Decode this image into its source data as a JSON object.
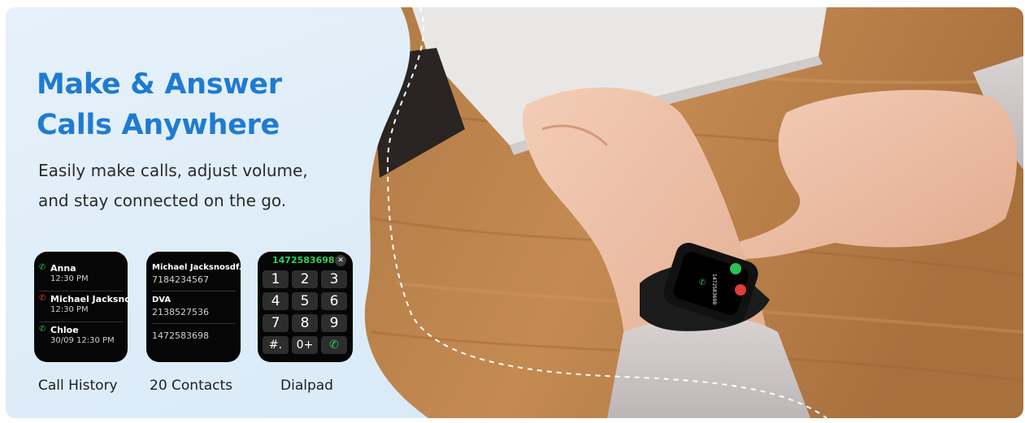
{
  "headline": {
    "line1": "Make & Answer",
    "line2": "Calls Anywhere"
  },
  "subtitle": {
    "line1": "Easily make calls, adjust volume,",
    "line2": "and stay connected on the go."
  },
  "call_history": {
    "entries": [
      {
        "name": "Anna",
        "time": "12:30 PM",
        "status": "incoming",
        "icon": "phone-incoming-icon"
      },
      {
        "name": "Michael Jacksno...",
        "time": "12:30 PM",
        "status": "missed",
        "icon": "phone-missed-icon"
      },
      {
        "name": "Chloe",
        "time": "30/09 12:30 PM",
        "status": "incoming",
        "icon": "phone-incoming-icon"
      }
    ],
    "caption": "Call History"
  },
  "contacts": {
    "entries": [
      {
        "name": "Michael Jacksnosdf...",
        "number": "7184234567"
      },
      {
        "name": "DVA",
        "number": "2138527536"
      },
      {
        "name": "",
        "number": "1472583698"
      }
    ],
    "caption": "20 Contacts"
  },
  "dialpad": {
    "number": "1472583698",
    "close_symbol": "✕",
    "keys": [
      "1",
      "2",
      "3",
      "4",
      "5",
      "6",
      "7",
      "8",
      "9",
      "#.",
      "0+",
      "✆"
    ],
    "caption": "Dialpad"
  },
  "colors": {
    "headline": "#1f7bd1",
    "panel_background": "#dcecf8",
    "watch_screen": "#060606",
    "accept_green": "#2fbf55",
    "decline_red": "#e23b3b",
    "dashed_line": "#ffffff"
  }
}
